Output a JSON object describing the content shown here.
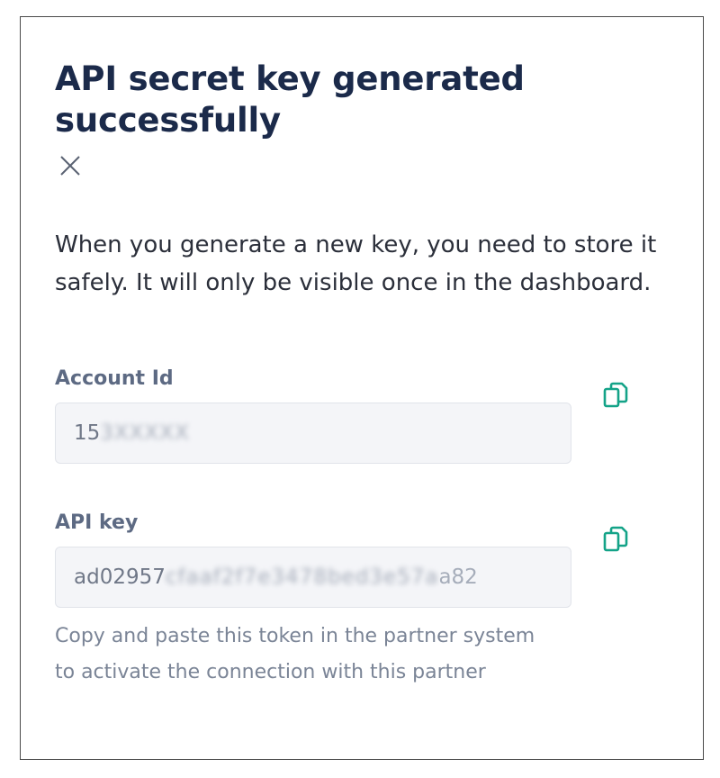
{
  "dialog": {
    "title": "API secret key generated successfully",
    "close_icon": "close-icon",
    "description": "When you generate a new key, you need to store it safely. It will only be visible once in the dashboard.",
    "account_id": {
      "label": "Account Id",
      "value_visible": "15",
      "value_masked": "3XXXXX",
      "copy_icon": "copy-icon"
    },
    "api_key": {
      "label": "API key",
      "value_visible": "ad02957",
      "value_masked": "cfaaf2f7e3478bed3e57a",
      "value_tail": "a82",
      "copy_icon": "copy-icon"
    },
    "helper_text": "Copy and paste this token in the partner system to activate the connection with this partner"
  },
  "colors": {
    "title": "#1b2a4a",
    "accent_teal": "#14a388",
    "label": "#5d6a83",
    "helper": "#7a8496",
    "input_bg": "#f4f5f8"
  }
}
